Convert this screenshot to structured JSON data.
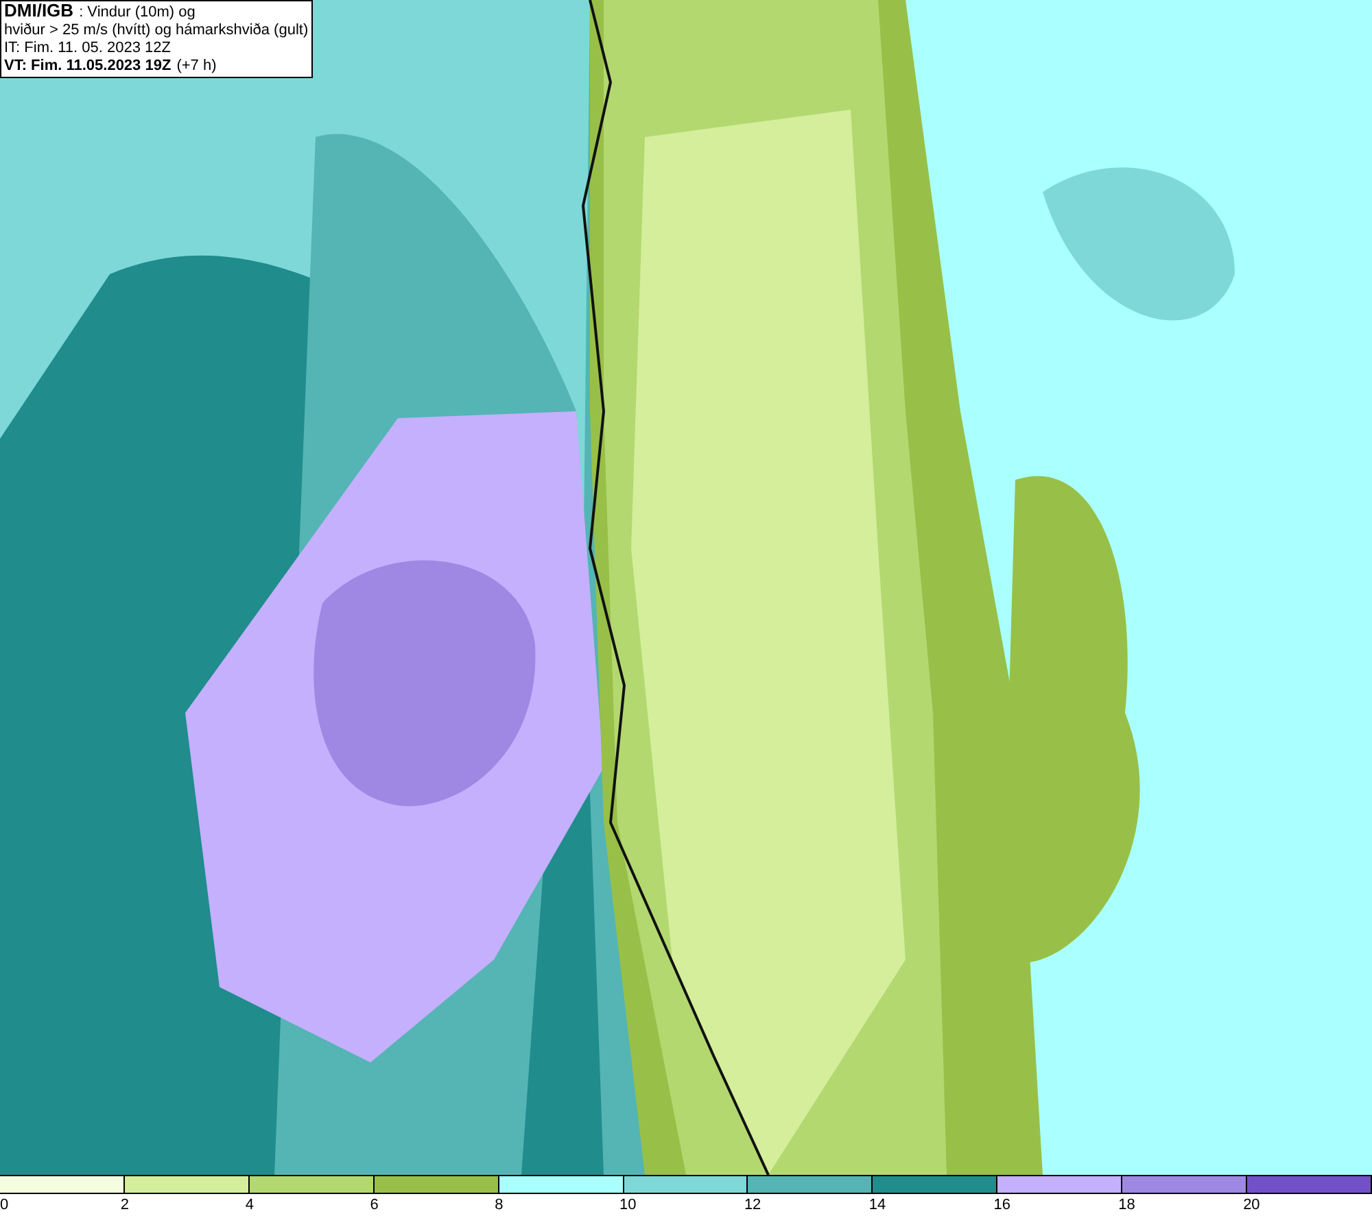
{
  "header": {
    "source": "DMI/IGB",
    "title": ": Vindur (10m) og",
    "subtitle": "hviður > 25 m/s (hvítt) og hámarkshviða (gult)",
    "initial_time": "IT: Fim. 11. 05. 2023 12Z",
    "valid_time": "VT: Fim. 11.05.2023 19Z",
    "lead": "(+7 h)"
  },
  "legend": {
    "bins": [
      {
        "color": "#f5fde0",
        "label": "0"
      },
      {
        "color": "#d4ee9c",
        "label": "2"
      },
      {
        "color": "#b3d870",
        "label": "4"
      },
      {
        "color": "#98c048",
        "label": "6"
      },
      {
        "color": "#aaffff",
        "label": "8"
      },
      {
        "color": "#7fd8d8",
        "label": "10"
      },
      {
        "color": "#55b4b4",
        "label": "12"
      },
      {
        "color": "#208c8c",
        "label": "14"
      },
      {
        "color": "#c4b0fc",
        "label": "16"
      },
      {
        "color": "#9f87e4",
        "label": "18"
      },
      {
        "color": "#7251c8",
        "label": "20"
      }
    ]
  }
}
